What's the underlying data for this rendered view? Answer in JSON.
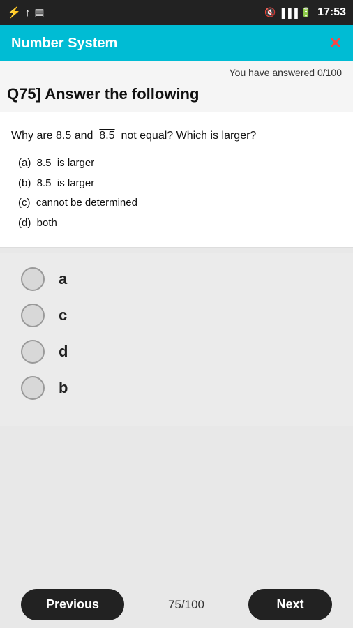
{
  "statusBar": {
    "time": "17:53",
    "icons_left": [
      "usb-icon",
      "upload-icon",
      "file-icon"
    ],
    "icons_right": [
      "mute-icon",
      "signal-icon",
      "battery-icon"
    ]
  },
  "header": {
    "title": "Number System",
    "close_label": "✕"
  },
  "progress": {
    "text": "You have answered 0/100"
  },
  "question": {
    "label": "Q75]  Answer the following",
    "text": "Why are 8.5 and  8.5̄  not equal? Which is larger?",
    "options": [
      "(a)  8.5  is larger",
      "(b)  8.5̄  is larger",
      "(c)  cannot be determined",
      "(d)  both"
    ]
  },
  "choices": [
    {
      "id": "a",
      "label": "a"
    },
    {
      "id": "c",
      "label": "c"
    },
    {
      "id": "d",
      "label": "d"
    },
    {
      "id": "b",
      "label": "b"
    }
  ],
  "navigation": {
    "previous_label": "Previous",
    "next_label": "Next",
    "page_count": "75/100"
  }
}
